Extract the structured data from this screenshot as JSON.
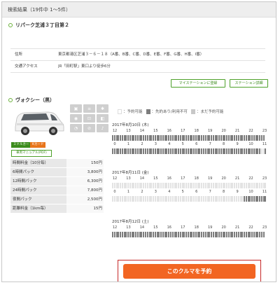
{
  "header": {
    "title": "検索結果（19件中 1～5件）"
  },
  "station": {
    "name": "リパーク芝浦３丁目第２",
    "rows": [
      {
        "label": "住所",
        "value": "東京都港区芝浦３－６－１８（A番、B番、C番、D番、E番、F番、G番、H番、I番）"
      },
      {
        "label": "交通アクセス",
        "value": "JR「田町駅」東口より徒歩6分"
      }
    ],
    "buttons": {
      "register": "マイステーションに登録",
      "detail": "ステーション詳細"
    }
  },
  "car": {
    "name": "ヴォクシー（黒）",
    "tags": {
      "minivan": "ミドルカー",
      "kcard": "Kカード"
    },
    "manual": "車両マニュアル(PDF)",
    "prices": [
      {
        "label": "時間料金（10分毎）",
        "value": "150円"
      },
      {
        "label": "6時間パック",
        "value": "3,800円"
      },
      {
        "label": "12時間パック",
        "value": "6,300円"
      },
      {
        "label": "24時間パック",
        "value": "7,800円"
      },
      {
        "label": "夜間パック",
        "value": "2,500円"
      },
      {
        "label": "距離料金（1km毎）",
        "value": "15円"
      }
    ]
  },
  "legend": {
    "available": "：予約可能",
    "reserved": "：先約あり/利用不可",
    "not_yet": "：まだ予約可能"
  },
  "colors": {
    "accent": "#f26522",
    "green": "#4ea12a",
    "reserved": "#7d7d7d",
    "available": "#e3e3e3"
  },
  "days": [
    {
      "date": "2017年8月10日 (木)",
      "row1": {
        "hours": [
          "12",
          "13",
          "14",
          "15",
          "16",
          "17",
          "18",
          "19",
          "20",
          "21",
          "22",
          "23"
        ],
        "pattern": "RRRRRRRRRRRRRRRRRRRRRRRRRRRRRRRRRRRRRRRRRRRRRRRRRRRRRRRRRRRRRRRRRRRRRRRRRRRRRRR"
      },
      "row2": {
        "hours": [
          "0",
          "1",
          "2",
          "3",
          "4",
          "5",
          "6",
          "7",
          "8",
          "9",
          "10",
          "11"
        ],
        "pattern": "RRRRRRRRRRRRRRRRRRRRRRRRRRRRRRRRRRRRRRRRRRRRRRRRRRRRRRRRRRRRRRRRRRRRRRRRRRRRRAAR"
      }
    },
    {
      "date": "2017年8月11日 (金)",
      "row1": {
        "hours": [
          "12",
          "13",
          "14",
          "15",
          "16",
          "17",
          "18",
          "19",
          "20",
          "21",
          "22",
          "23"
        ],
        "pattern": "AAAAAAAAAAAAAAAAAAAAAAAAAAAAAAAAAAAAAAAAAAAAAAAAAAAAAAAAAAAAAAAAAAAAAAAAAAAAAAAA"
      },
      "row2": {
        "hours": [
          "0",
          "1",
          "2",
          "3",
          "4",
          "5",
          "6",
          "7",
          "8",
          "9",
          "10",
          "11"
        ],
        "pattern": "AAAAAAAAAAAAAAAAAAAAAAAAAAAAAAAAAAAAAAAAAAAAAAAAAAAAAAAAAAAAAAAAAAAARRRRRRRRRRRR"
      }
    },
    {
      "date": "2017年8月12日 (土)",
      "row1": {
        "hours": [
          "12",
          "13",
          "14",
          "15",
          "16",
          "17",
          "18",
          "19",
          "20",
          "21",
          "22",
          "23"
        ],
        "pattern": "RRRRRRRRRRRRRRRRRRRRRRRRRRRRRRRRRRRRRRRRRRRRRRRRRRRRRRRRRRRRRRRRRRRRRRRRRRRRRRR"
      },
      "row2": {
        "hours": [],
        "pattern": ""
      }
    }
  ],
  "reserve_button": "このクルマを予約"
}
